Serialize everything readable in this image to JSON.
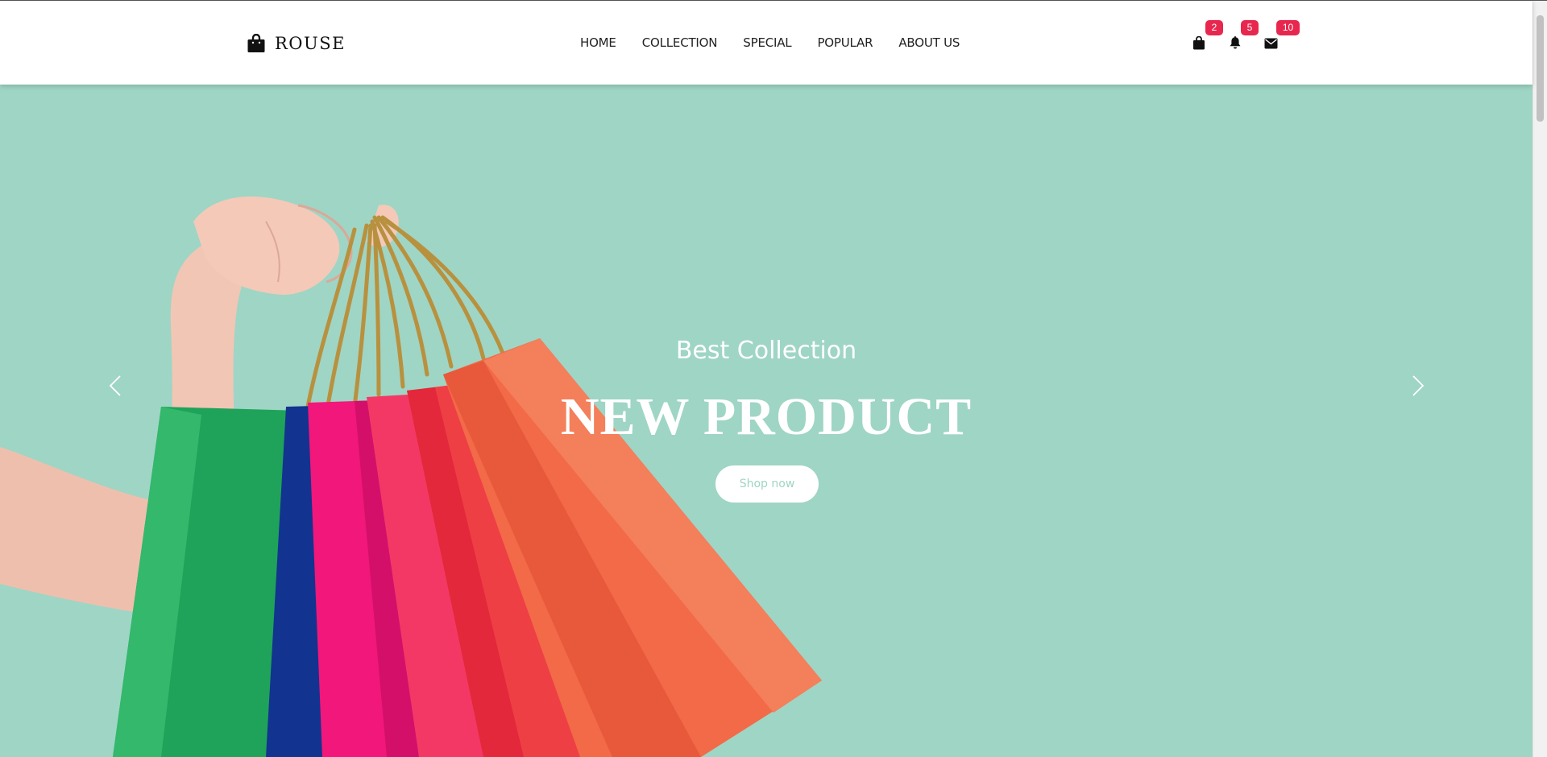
{
  "brand": {
    "name": "ROUSE",
    "icon": "shopping-bag-icon"
  },
  "nav": {
    "items": [
      {
        "label": "HOME"
      },
      {
        "label": "COLLECTION"
      },
      {
        "label": "SPECIAL"
      },
      {
        "label": "POPULAR"
      },
      {
        "label": "ABOUT US"
      }
    ]
  },
  "actions": {
    "cart": {
      "icon": "shopping-bag-icon",
      "count": "2"
    },
    "notifications": {
      "icon": "bell-icon",
      "count": "5"
    },
    "messages": {
      "icon": "envelope-icon",
      "count": "10"
    }
  },
  "hero": {
    "subtitle": "Best Collection",
    "title": "NEW PRODUCT",
    "button_label": "Shop now",
    "prev_icon": "chevron-left-icon",
    "next_icon": "chevron-right-icon",
    "background_color": "#9fd5c5"
  },
  "colors": {
    "accent_badge": "#e8274e",
    "hero_bg": "#9fd5c5",
    "text_dark": "#222222"
  }
}
